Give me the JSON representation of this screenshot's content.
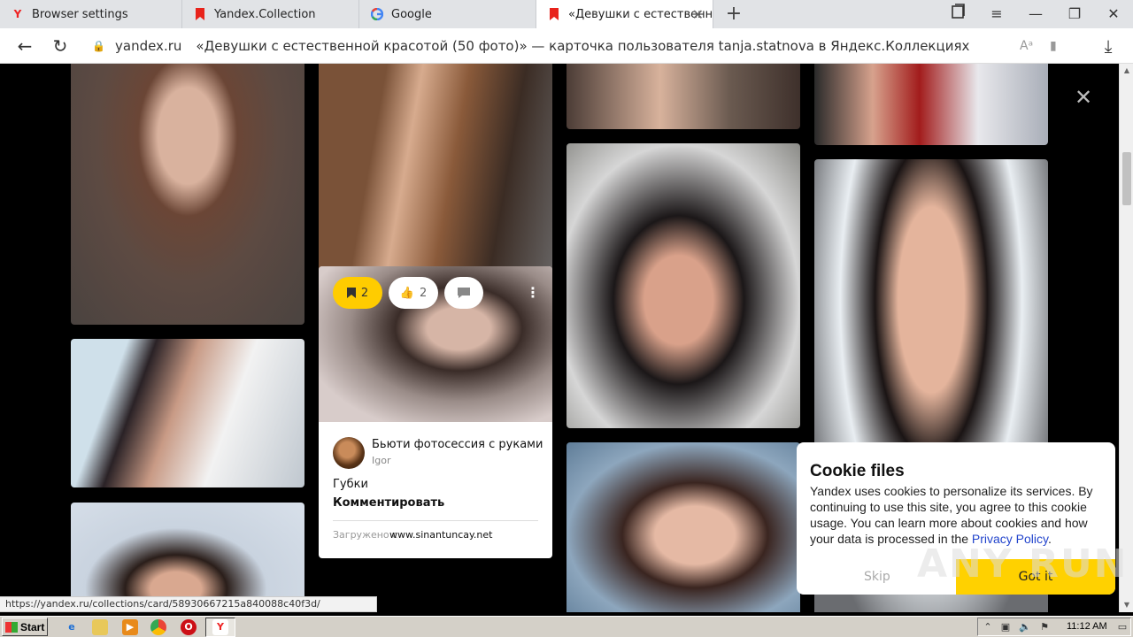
{
  "tabs": [
    {
      "label": "Browser settings",
      "icon": "yandex-icon",
      "active": false
    },
    {
      "label": "Yandex.Collection",
      "icon": "collections-icon",
      "active": false
    },
    {
      "label": "Google",
      "icon": "google-icon",
      "active": false
    },
    {
      "label": "«Девушки с естественн",
      "icon": "collections-icon",
      "active": true
    }
  ],
  "address": {
    "domain": "yandex.ru",
    "title": "«Девушки с естественной красотой (50 фото)» — карточка пользователя tanja.statnova в Яндекс.Коллекциях"
  },
  "card": {
    "save_count": "2",
    "like_count": "2",
    "board_title": "Бьюти фотосессия с руками",
    "board_user": "Igor",
    "description": "Губки",
    "comment_label": "Комментировать",
    "source_prefix": "Загружено с",
    "source": "www.sinantuncay.net"
  },
  "cookie": {
    "title": "Cookie files",
    "text": "Yandex uses cookies to personalize its services. By continuing to use this site, you agree to this cookie usage. You can learn more about cookies and how your data is processed in the",
    "link": "Privacy Policy",
    "period": ".",
    "skip": "Skip",
    "accept": "Got it"
  },
  "watermark": "ANY RUN",
  "status_url": "https://yandex.ru/collections/card/58930667215a840088c40f3d/",
  "taskbar": {
    "start": "Start",
    "clock": "11:12 AM"
  },
  "colors": {
    "accent_yellow": "#ffcc00",
    "link_blue": "#2244cc",
    "page_bg": "#000000"
  }
}
